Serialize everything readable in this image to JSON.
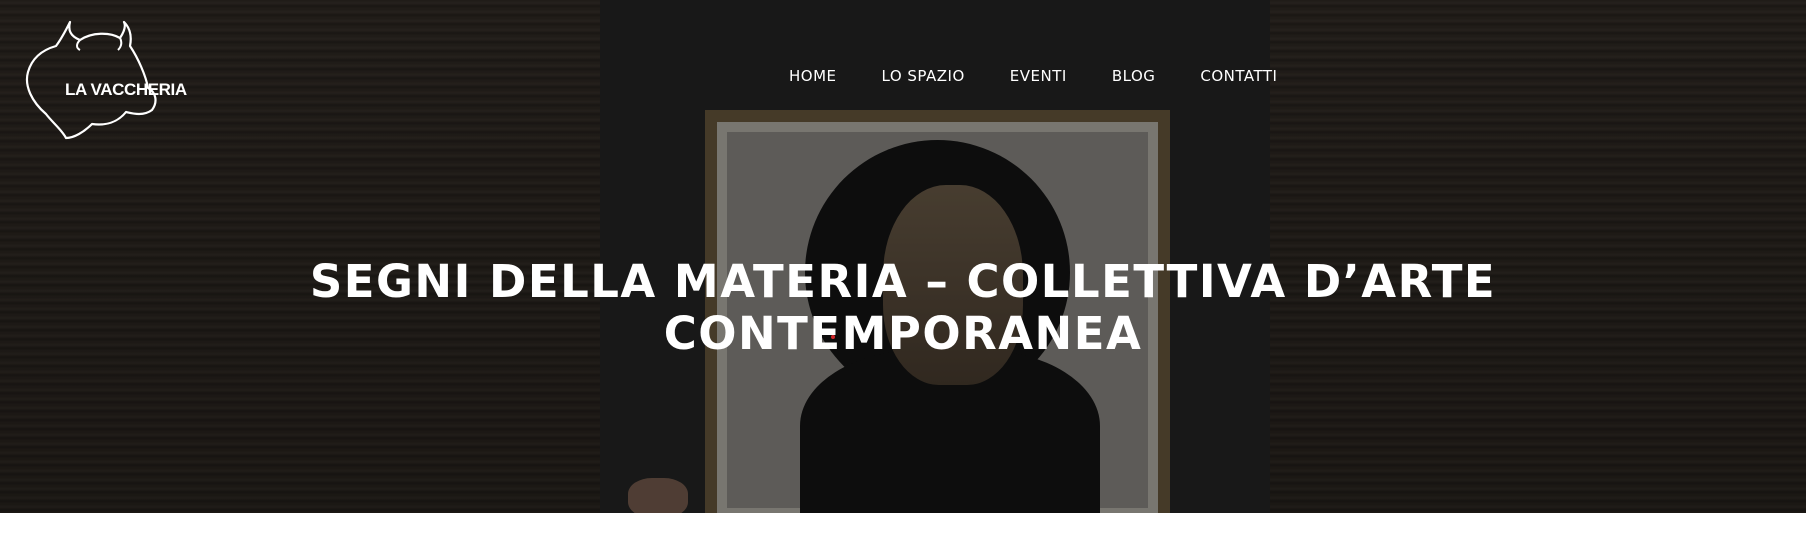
{
  "site": {
    "logo_text": "LA VACCHERIA"
  },
  "nav": {
    "items": [
      {
        "label": "HOME"
      },
      {
        "label": "LO SPAZIO"
      },
      {
        "label": "EVENTI"
      },
      {
        "label": "BLOG"
      },
      {
        "label": "CONTATTI"
      }
    ]
  },
  "hero": {
    "title_line1": "SEGNI DELLA MATERIA – COLLETTIVA D’ARTE",
    "title_line2": "CONTEMPORANEA"
  },
  "colors": {
    "accent": "#d3262a",
    "text": "#ffffff"
  }
}
